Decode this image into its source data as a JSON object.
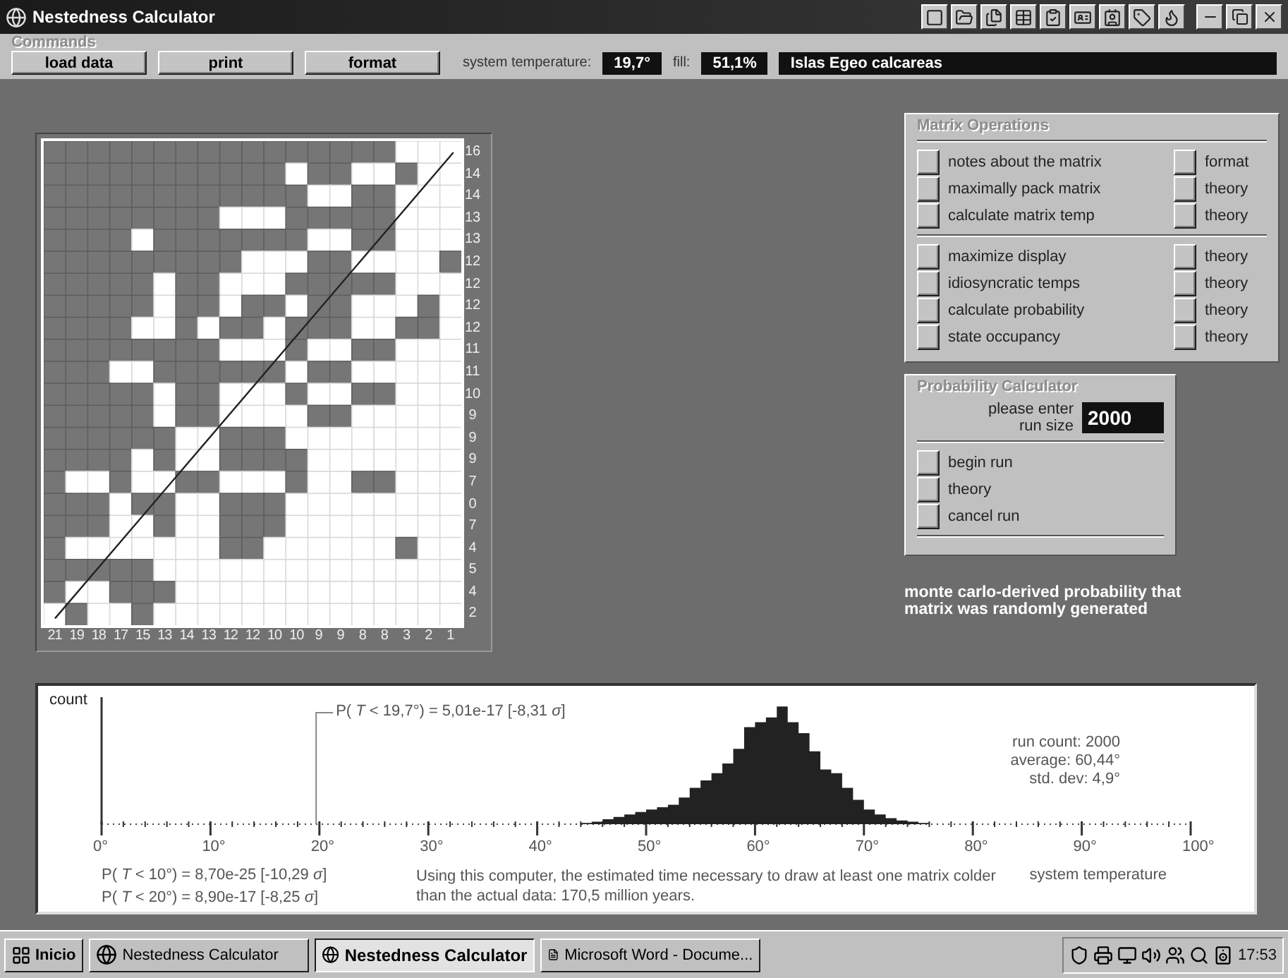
{
  "window": {
    "title": "Nestedness Calculator"
  },
  "commands": {
    "title": "Commands",
    "buttons": [
      "load data",
      "print",
      "format"
    ],
    "temperature_label": "system temperature:",
    "temperature": "19,7°",
    "fill_label": "fill:",
    "fill": "51,1%",
    "dataset": "Islas Egeo calcareas"
  },
  "matrix": {
    "columns": [
      "21",
      "19",
      "18",
      "17",
      "15",
      "13",
      "14",
      "13",
      "12",
      "12",
      "10",
      "10",
      "9",
      "9",
      "8",
      "8",
      "3",
      "2",
      "1"
    ],
    "rows": [
      {
        "label": "16",
        "cells": [
          true,
          true,
          true,
          true,
          true,
          true,
          true,
          true,
          true,
          true,
          true,
          true,
          true,
          true,
          true,
          true,
          false,
          false,
          false
        ]
      },
      {
        "label": "14",
        "cells": [
          true,
          true,
          true,
          true,
          true,
          true,
          true,
          true,
          true,
          true,
          true,
          false,
          true,
          true,
          false,
          false,
          true,
          false,
          false
        ]
      },
      {
        "label": "14",
        "cells": [
          true,
          true,
          true,
          true,
          true,
          true,
          true,
          true,
          true,
          true,
          true,
          true,
          false,
          false,
          true,
          true,
          false,
          false,
          false
        ]
      },
      {
        "label": "13",
        "cells": [
          true,
          true,
          true,
          true,
          true,
          true,
          true,
          true,
          false,
          false,
          false,
          true,
          true,
          true,
          true,
          true,
          false,
          false,
          false
        ]
      },
      {
        "label": "13",
        "cells": [
          true,
          true,
          true,
          true,
          false,
          true,
          true,
          true,
          true,
          true,
          true,
          true,
          false,
          false,
          true,
          true,
          false,
          false,
          false
        ]
      },
      {
        "label": "12",
        "cells": [
          true,
          true,
          true,
          true,
          true,
          true,
          true,
          true,
          true,
          false,
          false,
          false,
          true,
          true,
          false,
          false,
          false,
          false,
          true
        ]
      },
      {
        "label": "12",
        "cells": [
          true,
          true,
          true,
          true,
          true,
          false,
          true,
          true,
          false,
          false,
          false,
          true,
          true,
          true,
          true,
          true,
          false,
          false,
          false
        ]
      },
      {
        "label": "12",
        "cells": [
          true,
          true,
          true,
          true,
          true,
          false,
          true,
          true,
          false,
          true,
          true,
          false,
          true,
          true,
          false,
          false,
          false,
          true,
          false
        ]
      },
      {
        "label": "12",
        "cells": [
          true,
          true,
          true,
          true,
          false,
          false,
          true,
          false,
          true,
          true,
          false,
          true,
          true,
          true,
          false,
          false,
          true,
          true,
          false
        ]
      },
      {
        "label": "11",
        "cells": [
          true,
          true,
          true,
          true,
          true,
          true,
          true,
          true,
          false,
          false,
          false,
          true,
          false,
          false,
          true,
          true,
          false,
          false,
          false
        ]
      },
      {
        "label": "11",
        "cells": [
          true,
          true,
          true,
          false,
          false,
          true,
          true,
          true,
          true,
          true,
          true,
          false,
          true,
          true,
          false,
          false,
          false,
          false,
          false
        ]
      },
      {
        "label": "10",
        "cells": [
          true,
          true,
          true,
          true,
          true,
          false,
          true,
          true,
          false,
          false,
          false,
          true,
          false,
          false,
          true,
          true,
          false,
          false,
          false
        ]
      },
      {
        "label": "9",
        "cells": [
          true,
          true,
          true,
          true,
          true,
          false,
          true,
          true,
          false,
          false,
          false,
          false,
          true,
          true,
          false,
          false,
          false,
          false,
          false
        ]
      },
      {
        "label": "9",
        "cells": [
          true,
          true,
          true,
          true,
          true,
          true,
          false,
          false,
          true,
          true,
          true,
          false,
          false,
          false,
          false,
          false,
          false,
          false,
          false
        ]
      },
      {
        "label": "9",
        "cells": [
          true,
          true,
          true,
          true,
          false,
          true,
          false,
          false,
          true,
          true,
          true,
          true,
          false,
          false,
          false,
          false,
          false,
          false,
          false
        ]
      },
      {
        "label": "7",
        "cells": [
          true,
          false,
          false,
          true,
          false,
          false,
          true,
          true,
          false,
          false,
          false,
          true,
          false,
          false,
          true,
          true,
          false,
          false,
          false
        ]
      },
      {
        "label": "0",
        "cells": [
          true,
          true,
          true,
          false,
          true,
          true,
          false,
          false,
          true,
          true,
          true,
          false,
          false,
          false,
          false,
          false,
          false,
          false,
          false
        ]
      },
      {
        "label": "7",
        "cells": [
          true,
          true,
          true,
          false,
          false,
          true,
          false,
          false,
          true,
          true,
          true,
          false,
          false,
          false,
          false,
          false,
          false,
          false,
          false
        ]
      },
      {
        "label": "4",
        "cells": [
          true,
          false,
          false,
          false,
          false,
          false,
          false,
          false,
          true,
          true,
          false,
          false,
          false,
          false,
          false,
          false,
          true,
          false,
          false
        ]
      },
      {
        "label": "5",
        "cells": [
          true,
          true,
          true,
          true,
          true,
          false,
          false,
          false,
          false,
          false,
          false,
          false,
          false,
          false,
          false,
          false,
          false,
          false,
          false
        ]
      },
      {
        "label": "4",
        "cells": [
          true,
          false,
          false,
          true,
          true,
          true,
          false,
          false,
          false,
          false,
          false,
          false,
          false,
          false,
          false,
          false,
          false,
          false,
          false
        ]
      },
      {
        "label": "2",
        "cells": [
          false,
          true,
          false,
          false,
          true,
          false,
          false,
          false,
          false,
          false,
          false,
          false,
          false,
          false,
          false,
          false,
          false,
          false,
          false
        ]
      }
    ]
  },
  "matrix_operations": {
    "title": "Matrix Operations",
    "sections": [
      {
        "items": [
          {
            "label": "notes about the matrix",
            "side": "format"
          },
          {
            "label": "maximally pack matrix",
            "side": "theory"
          },
          {
            "label": "calculate matrix temp",
            "side": "theory"
          }
        ]
      },
      {
        "items": [
          {
            "label": "maximize display",
            "side": "theory"
          },
          {
            "label": "idiosyncratic temps",
            "side": "theory"
          },
          {
            "label": "calculate probability",
            "side": "theory"
          },
          {
            "label": "state occupancy",
            "side": "theory"
          }
        ]
      }
    ]
  },
  "probability_calculator": {
    "title": "Probability Calculator",
    "prompt": "please enter run size",
    "run_size": "2000",
    "buttons": [
      "begin run",
      "theory",
      "cancel run"
    ]
  },
  "probability_note": "monte carlo-derived probability that matrix was randomly generated",
  "histogram": {
    "y_label": "count",
    "x_ticks": [
      "0°",
      "10°",
      "20°",
      "30°",
      "40°",
      "50°",
      "60°",
      "70°",
      "80°",
      "90°",
      "100°"
    ],
    "x_label": "system temperature",
    "observed": "P( *T* < 19,7°) = 5,01e-17   [-8,31 *σ*]",
    "thresholds": [
      "P( *T* < 10°) = 8,70e-25   [-10,29 *σ*]",
      "P( *T* < 20°) = 8,90e-17   [-8,25 *σ*]"
    ],
    "estimate": "Using this computer, the estimated time necessary to draw at least one matrix colder than the actual data: 170,5 million years.",
    "stats": [
      "run count:  2000",
      "average: 60,44°",
      "std. dev: 4,9°"
    ]
  },
  "taskbar": {
    "start": "Inicio",
    "tasks": [
      {
        "label": "Nestedness Calculator",
        "selected": false
      },
      {
        "label": "Nestedness Calculator",
        "selected": true
      },
      {
        "label": "Microsoft Word - Docume...",
        "selected": false
      }
    ],
    "clock": "17:53"
  }
}
